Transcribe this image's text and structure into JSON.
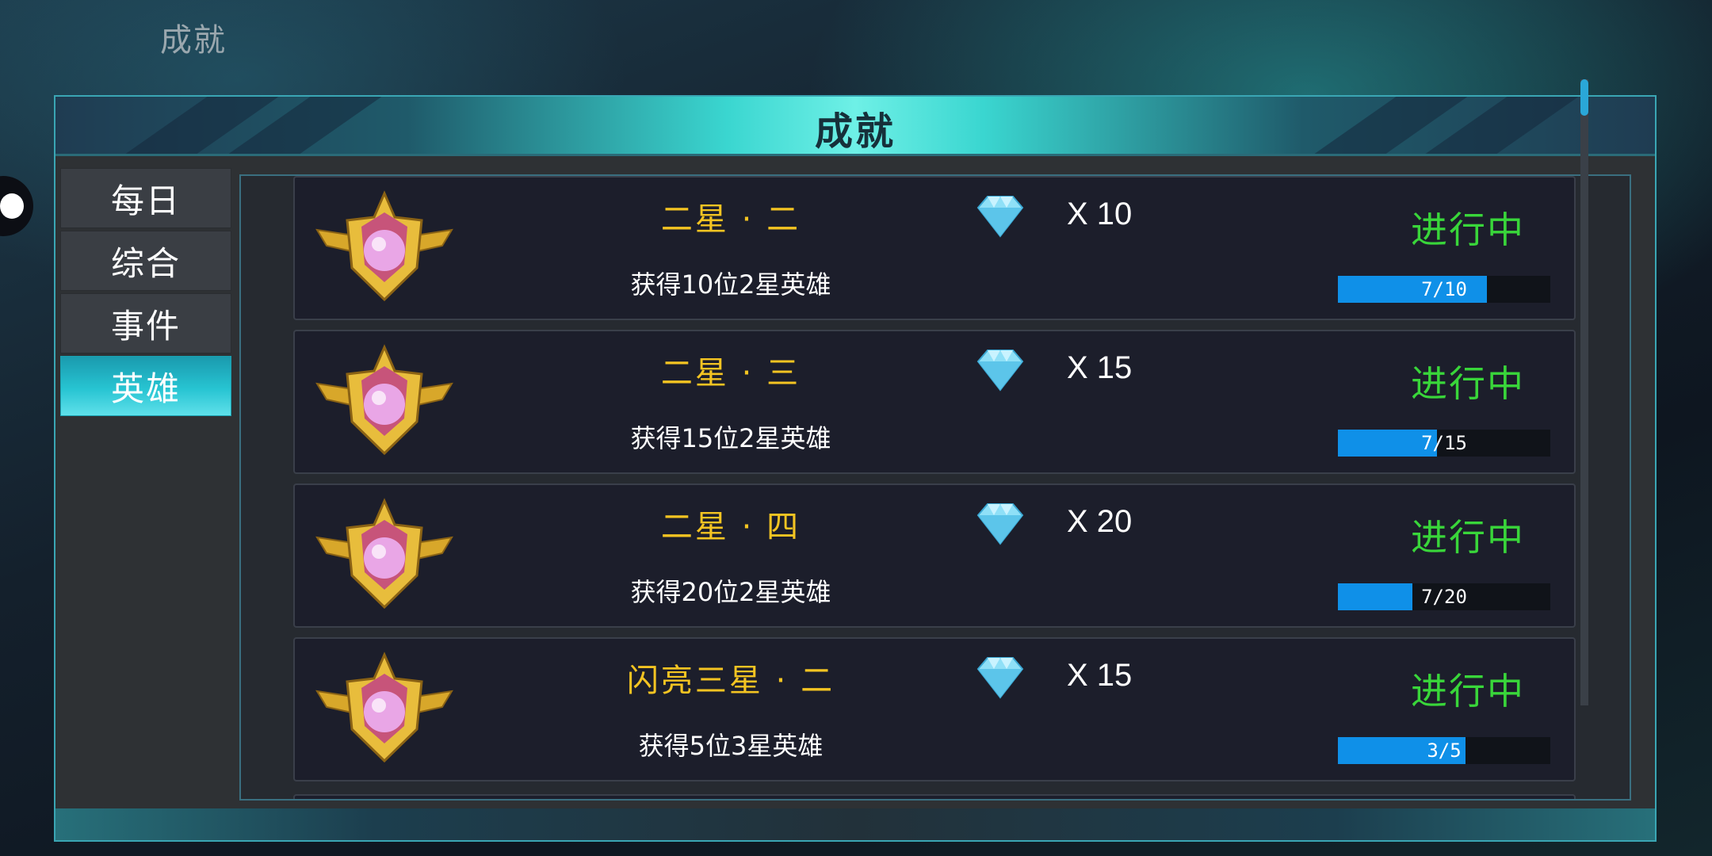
{
  "page": {
    "title": "成就"
  },
  "window": {
    "title": "成就"
  },
  "sidebar": {
    "tabs": [
      {
        "label": "每日",
        "active": false
      },
      {
        "label": "综合",
        "active": false
      },
      {
        "label": "事件",
        "active": false
      },
      {
        "label": "英雄",
        "active": true
      }
    ]
  },
  "achievements": [
    {
      "name": "二星 · 二",
      "desc": "获得10位2星英雄",
      "reward": "X 10",
      "reward_icon": "diamond-icon",
      "status": "进行中",
      "progress_text": "7/10",
      "progress": 0.7
    },
    {
      "name": "二星 · 三",
      "desc": "获得15位2星英雄",
      "reward": "X 15",
      "reward_icon": "diamond-icon",
      "status": "进行中",
      "progress_text": "7/15",
      "progress": 0.4667
    },
    {
      "name": "二星 · 四",
      "desc": "获得20位2星英雄",
      "reward": "X 20",
      "reward_icon": "diamond-icon",
      "status": "进行中",
      "progress_text": "7/20",
      "progress": 0.35
    },
    {
      "name": "闪亮三星 · 二",
      "desc": "获得5位3星英雄",
      "reward": "X 15",
      "reward_icon": "diamond-icon",
      "status": "进行中",
      "progress_text": "3/5",
      "progress": 0.6
    }
  ],
  "colors": {
    "name": "#f4c422",
    "status": "#39d63a",
    "progress_fill": "#0f90e8",
    "tab_active": "#27c4d2",
    "frame": "#3aa6b4"
  }
}
